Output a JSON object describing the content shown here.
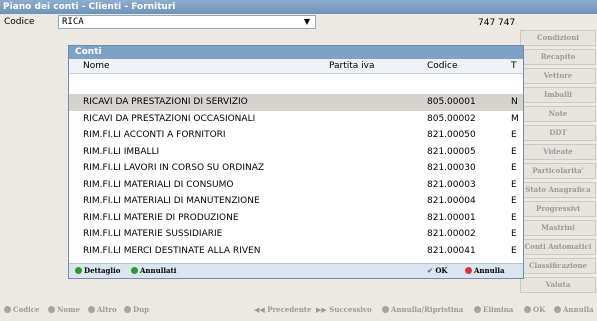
{
  "window": {
    "title": "Piano dei conti - Clienti - Fornituri"
  },
  "codice": {
    "label": "Codice",
    "value": "RICA",
    "count": "747 747"
  },
  "right_buttons": [
    "Condizioni",
    "Recapito",
    "Vettore",
    "Imballi",
    "Note",
    "DDT",
    "Videate",
    "Particolarita'",
    "Stato Anagrafica",
    "Progressivi",
    "Mastrini",
    "Conti Automatici",
    "Classificazione",
    "Valuta"
  ],
  "popup": {
    "title": "Conti",
    "columns": {
      "nome": "Nome",
      "piva": "Partita iva",
      "codice": "Codice",
      "t": "T"
    },
    "rows": [
      {
        "nome": "RICAVI DA PRESTAZIONI DI SERVIZIO",
        "piva": "",
        "codice": "805.00001",
        "t": "N"
      },
      {
        "nome": "RICAVI DA PRESTAZIONI OCCASIONALI",
        "piva": "",
        "codice": "805.00002",
        "t": "M"
      },
      {
        "nome": "RIM.FI.LI ACCONTI A FORNITORI",
        "piva": "",
        "codice": "821.00050",
        "t": "E"
      },
      {
        "nome": "RIM.FI.LI IMBALLI",
        "piva": "",
        "codice": "821.00005",
        "t": "E"
      },
      {
        "nome": "RIM.FI.LI LAVORI IN CORSO SU ORDINAZ",
        "piva": "",
        "codice": "821.00030",
        "t": "E"
      },
      {
        "nome": "RIM.FI.LI MATERIALI DI CONSUMO",
        "piva": "",
        "codice": "821.00003",
        "t": "E"
      },
      {
        "nome": "RIM.FI.LI MATERIALI DI MANUTENZIONE",
        "piva": "",
        "codice": "821.00004",
        "t": "E"
      },
      {
        "nome": "RIM.FI.LI MATERIE DI PRODUZIONE",
        "piva": "",
        "codice": "821.00001",
        "t": "E"
      },
      {
        "nome": "RIM.FI.LI MATERIE SUSSIDIARIE",
        "piva": "",
        "codice": "821.00002",
        "t": "E"
      },
      {
        "nome": "RIM.FI.LI MERCI DESTINATE ALLA RIVEN",
        "piva": "",
        "codice": "821.00041",
        "t": "E"
      }
    ],
    "footer": {
      "dettaglio": "Dettaglio",
      "annullati": "Annullati",
      "ok": "OK",
      "annulla": "Annulla"
    }
  },
  "bottom_bar": {
    "codice": "Codice",
    "nome": "Nome",
    "altro": "Altro",
    "dup": "Dup",
    "precedente": "Precedente",
    "successivo": "Successivo",
    "annulla_ripristina": "Annulla/Ripristina",
    "elimina": "Elimina",
    "ok": "OK",
    "annulla": "Annulla"
  },
  "colors": {
    "title_bg": "#7ea1c6",
    "selected_row": "#d6d3cf",
    "green": "#2c9a2c",
    "red": "#d23a3a",
    "ok_purple": "#7b5cc2"
  }
}
